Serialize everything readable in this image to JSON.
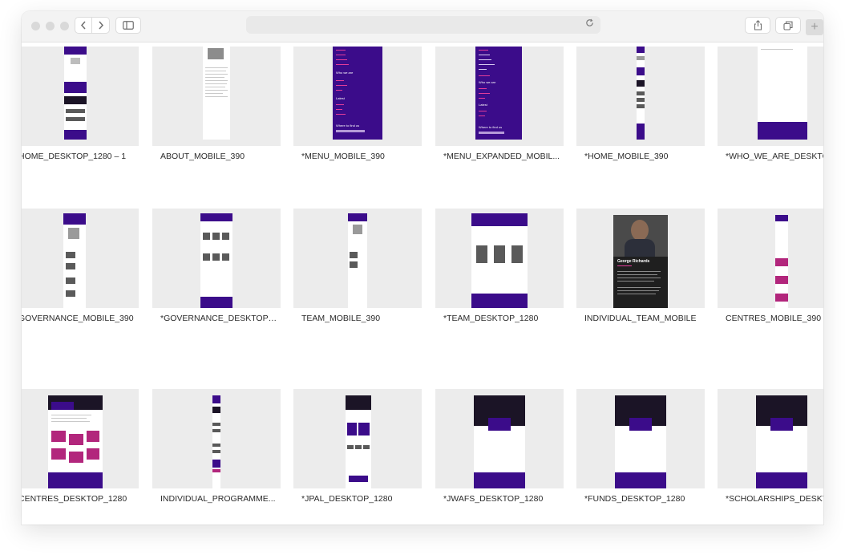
{
  "browser": {
    "back_icon": "chevron-left-icon",
    "forward_icon": "chevron-right-icon",
    "sidebar_icon": "sidebar-icon",
    "reload_icon": "reload-icon",
    "share_icon": "share-icon",
    "tabs_icon": "tabs-icon",
    "new_tab_icon": "plus-icon"
  },
  "frames": [
    {
      "label": "HOME_DESKTOP_1280 – 1"
    },
    {
      "label": "ABOUT_MOBILE_390"
    },
    {
      "label": "*MENU_MOBILE_390"
    },
    {
      "label": "*MENU_EXPANDED_MOBIL..."
    },
    {
      "label": "*HOME_MOBILE_390"
    },
    {
      "label": "*WHO_WE_ARE_DESKTOP"
    },
    {
      "label": "GOVERNANCE_MOBILE_390"
    },
    {
      "label": "*GOVERNANCE_DESKTOP_1..."
    },
    {
      "label": "TEAM_MOBILE_390"
    },
    {
      "label": "*TEAM_DESKTOP_1280"
    },
    {
      "label": "INDIVIDUAL_TEAM_MOBILE"
    },
    {
      "label": "CENTRES_MOBILE_390"
    },
    {
      "label": "CENTRES_DESKTOP_1280"
    },
    {
      "label": "INDIVIDUAL_PROGRAMME..."
    },
    {
      "label": "*JPAL_DESKTOP_1280"
    },
    {
      "label": "*JWAFS_DESKTOP_1280"
    },
    {
      "label": "*FUNDS_DESKTOP_1280"
    },
    {
      "label": "*SCHOLARSHIPS_DESKTOP"
    }
  ],
  "menu_preview": {
    "who_we_are": "Who we are",
    "latest": "Latest",
    "where_to_find_us": "Where to find us"
  },
  "profile_preview": {
    "name": "George Richards"
  }
}
